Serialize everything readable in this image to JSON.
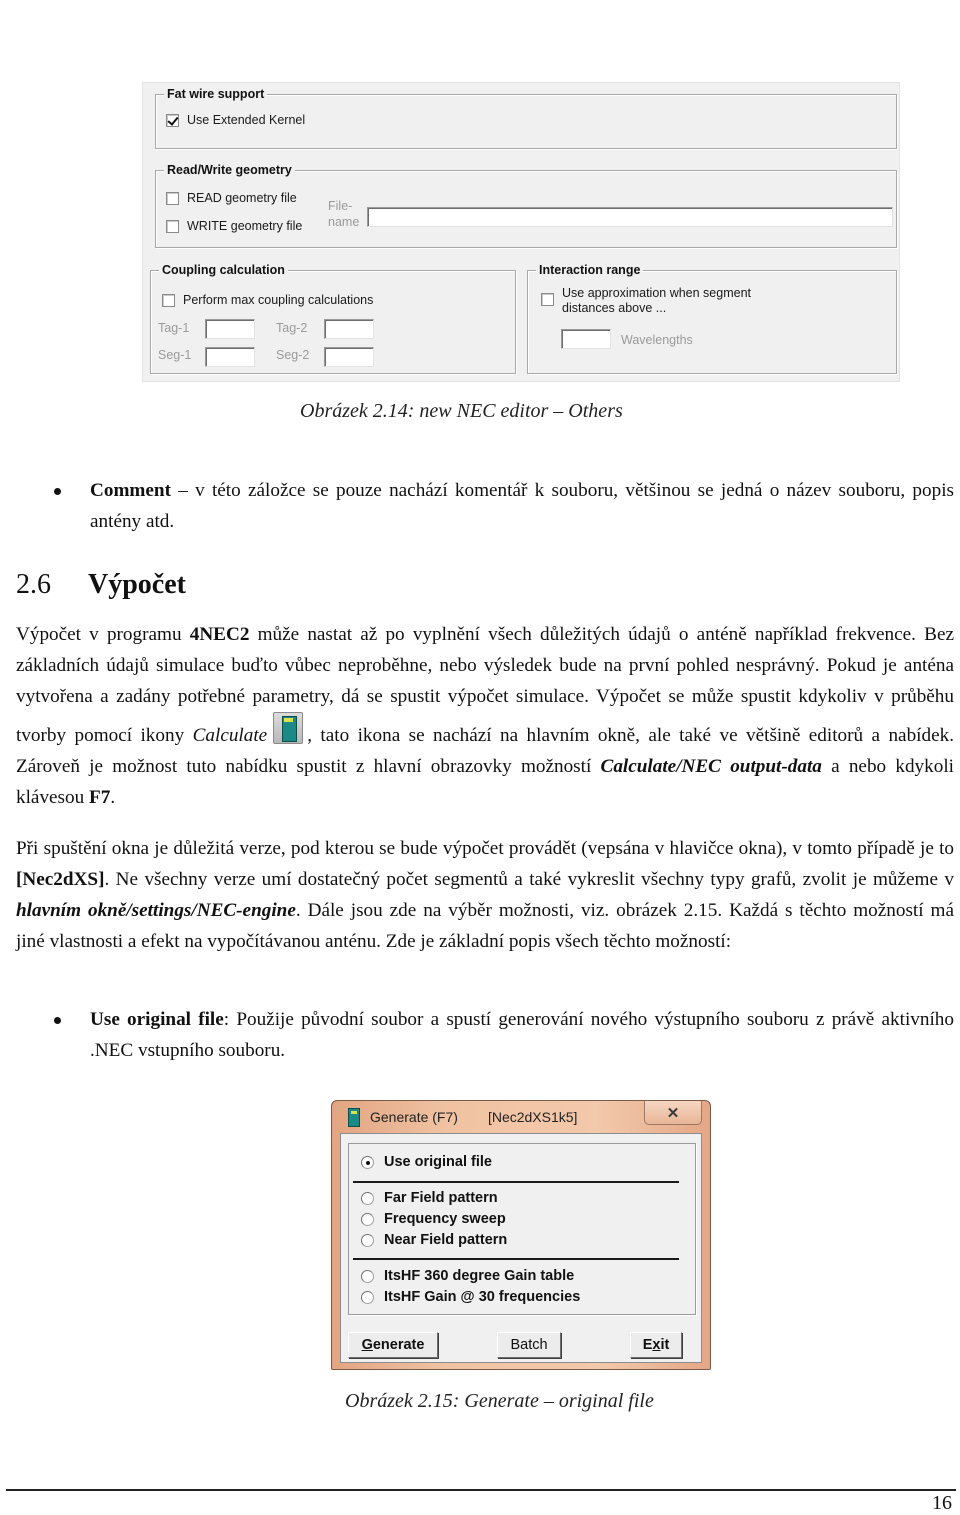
{
  "figure1": {
    "fat_wire": {
      "title": "Fat wire support",
      "extended_kernel": {
        "label": "Use Extended Kernel",
        "checked": true
      }
    },
    "rw_geometry": {
      "title": "Read/Write geometry",
      "read": {
        "label": "READ geometry file",
        "checked": false
      },
      "write": {
        "label": "WRITE geometry file",
        "checked": false
      },
      "filename_label_1": "File-",
      "filename_label_2": "name",
      "filename_value": ""
    },
    "coupling": {
      "title": "Coupling calculation",
      "max_coupling": {
        "label": "Perform max coupling calculations",
        "checked": false
      },
      "tag1_label": "Tag-1",
      "tag1_value": "",
      "tag2_label": "Tag-2",
      "tag2_value": "",
      "seg1_label": "Seg-1",
      "seg1_value": "",
      "seg2_label": "Seg-2",
      "seg2_value": ""
    },
    "interaction": {
      "title": "Interaction range",
      "approx_line1": "Use approximation when segment",
      "approx_line2": "distances above ...",
      "approx_checked": false,
      "wavelengths_label": "Wavelengths",
      "wavelengths_value": ""
    },
    "caption": "Obrázek 2.14: new NEC editor – Others"
  },
  "comment_item": {
    "term": "Comment",
    "text": " – v této záložce se pouze nachází komentář k souboru, většinou se jedná o název souboru, popis antény atd."
  },
  "section": {
    "number": "2.6",
    "title": "Výpočet"
  },
  "para1": {
    "a": "Výpočet v programu ",
    "b_bold": "4NEC2",
    "c": " může nastat až po vyplnění všech důležitých údajů o anténě například frekvence. Bez základních údajů simulace buďto vůbec neproběhne, nebo výsledek bude na první pohled nesprávný. Pokud je anténa vytvořena a zadány potřebné parametry, dá se spustit výpočet simulace. Výpočet se může spustit kdykoliv v průběhu tvorby pomocí ikony ",
    "d_italic": "Calculate",
    "e": ", tato ikona se nachází na hlavním okně, ale také ve většině editorů a nabídek. Zároveň je možnost tuto nabídku spustit z hlavní obrazovky možností ",
    "f_bolditalic": "Calculate/NEC output-data",
    "g": " a nebo kdykoli klávesou ",
    "h_bold": "F7",
    "i": "."
  },
  "para2": {
    "a": "Při spuštění okna je důležitá verze, pod kterou se bude výpočet provádět (vepsána v hlavičce okna), v tomto případě je to ",
    "b_bold": "[Nec2dXS]",
    "c": ". Ne všechny verze umí dostatečný počet segmentů a také vykreslit všechny typy grafů, zvolit je můžeme v ",
    "d_bolditalic": "hlavním okně/settings/NEC-engine",
    "e": ". Dále jsou zde na výběr možnosti, viz. obrázek 2.15. Každá s těchto možností má jiné vlastnosti a efekt na vypočítávanou anténu. Zde je základní popis všech těchto možností:"
  },
  "use_original_item": {
    "term": "Use original file",
    "text": ": Použije původní soubor a spustí generování nového výstupního souboru z právě aktivního .NEC vstupního souboru."
  },
  "figure2": {
    "window_title": "Generate (F7)",
    "engine": "[Nec2dXS1k5]",
    "close_glyph": "✕",
    "options": [
      {
        "label": "Use original file",
        "selected": true
      },
      {
        "label": "Far Field pattern",
        "selected": false
      },
      {
        "label": "Frequency sweep",
        "selected": false
      },
      {
        "label": "Near Field pattern",
        "selected": false
      },
      {
        "label": "ItsHF 360 degree Gain table",
        "selected": false
      },
      {
        "label": "ItsHF Gain @ 30 frequencies",
        "selected": false
      }
    ],
    "buttons": {
      "generate_u": "G",
      "generate_rest": "enerate",
      "batch": "Batch",
      "exit_a": "E",
      "exit_u": "x",
      "exit_rest": "it"
    },
    "caption": "Obrázek 2.15: Generate – original file"
  },
  "footer": {
    "page_number": "16"
  }
}
